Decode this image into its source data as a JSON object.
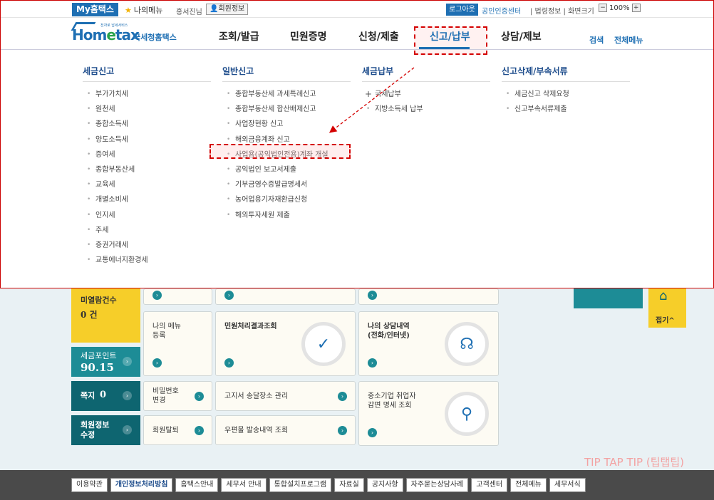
{
  "topbar": {
    "my_home": "My홈택스",
    "my_menu": "나의메뉴",
    "greeting": "홍서진님",
    "member_info": "회원정보",
    "logout": "로그아웃",
    "cert_center": "공인인증센터",
    "links": "| 법령정보 | 화면크기",
    "zoom": "100%"
  },
  "header": {
    "logo_tag": "전자로 납세서비스",
    "logo_word_a": "Hom",
    "logo_word_b": "e",
    "logo_word_c": "tax",
    "logo_kr": "국세청홈택스",
    "menu": [
      "조회/발급",
      "민원증명",
      "신청/제출",
      "신고/납부",
      "상담/제보"
    ],
    "search": "검색",
    "all_menu": "전체메뉴"
  },
  "mega": {
    "columns": [
      {
        "title": "세금신고",
        "items": [
          "부가가치세",
          "원천세",
          "종합소득세",
          "양도소득세",
          "증여세",
          "종합부동산세",
          "교육세",
          "개별소비세",
          "인지세",
          "주세",
          "증권거래세",
          "교통에너지환경세"
        ]
      },
      {
        "title": "일반신고",
        "items": [
          "종합부동산세 과세특례신고",
          "종합부동산세 합산배제신고",
          "사업장현황 신고",
          "해외금융계좌 신고",
          "사업용(공익법인전용)계좌 개설",
          "공익법인 보고서제출",
          "기부금영수증발급명세서",
          "농어업용기자재환급신청",
          "해외투자세원 제출"
        ]
      },
      {
        "title": "세금납부",
        "items": [
          "국세납부",
          "지방소득세 납부"
        ]
      },
      {
        "title": "신고삭제/부속서류",
        "items": [
          "세금신고 삭제요청",
          "신고부속서류제출"
        ]
      }
    ]
  },
  "dashboard": {
    "unread_label": "미열람건수",
    "unread_value": "0 건",
    "tax_point_label": "세금포인트",
    "tax_point_value": "90.15",
    "note_label": "쪽지",
    "note_value": "0",
    "member_edit": "회원정보\n수정",
    "my_menu_reg": "나의 메뉴\n등록",
    "civil_result": "민원처리결과조회",
    "my_consult": "나의 상담내역\n(전화/인터넷)",
    "password_change": "비밀번호\n변경",
    "notice_place": "고지서 송달장소 관리",
    "sme_exempt": "중소기업 취업자\n감면 명세 조회",
    "withdraw": "회원탈퇴",
    "mail_history": "우편물 발송내역 조회",
    "fold": "접기^"
  },
  "watermark": "TIP TAP TIP (팁탭팁)",
  "footer": {
    "links": [
      "이용약관",
      "개인정보처리방침",
      "홈택스안내",
      "세무서 안내",
      "통합설치프로그램",
      "자료실",
      "공지사항",
      "자주묻는상담사례",
      "고객센터",
      "전체메뉴",
      "세무서식"
    ]
  },
  "colors": {
    "brand": "#1e6fb3",
    "teal": "#1d8c96",
    "yellow": "#f6ce29",
    "highlight": "#d40000"
  }
}
